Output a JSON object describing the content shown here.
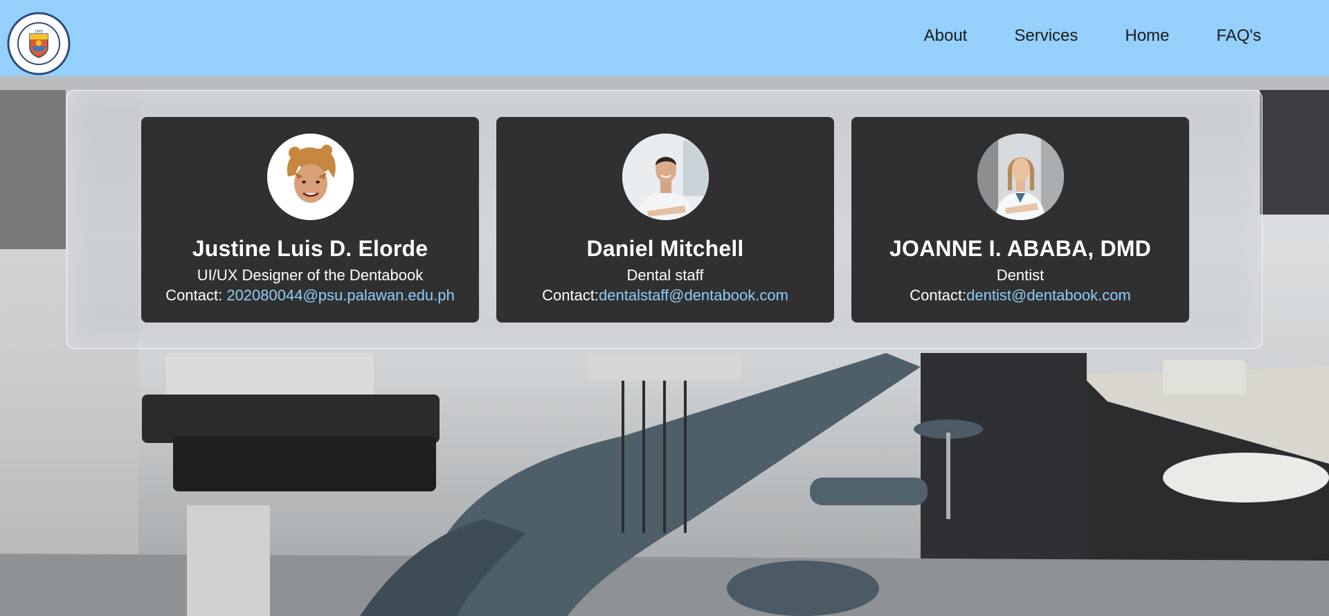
{
  "header": {
    "logo": {
      "icon": "university-seal-icon",
      "ring_text": "PALAWAN STATE UNIVERSITY",
      "bottom_text": "PHILIPPINES",
      "year": "1965"
    },
    "nav": [
      {
        "label": "About"
      },
      {
        "label": "Services"
      },
      {
        "label": "Home"
      },
      {
        "label": "FAQ's"
      }
    ],
    "background_color": "#94d0fb"
  },
  "team": [
    {
      "avatar": "cartoon-portrait-avatar",
      "name": "Justine Luis D. Elorde",
      "role": "UI/UX Designer of the Dentabook",
      "contact_label": "Contact: ",
      "email": "202080044@psu.palawan.edu.ph"
    },
    {
      "avatar": "male-staff-photo-avatar",
      "name": "Daniel Mitchell",
      "role": "Dental staff",
      "contact_label": "Contact:",
      "email": "dentalstaff@dentabook.com"
    },
    {
      "avatar": "female-dentist-photo-avatar",
      "name": "JOANNE I. ABABA, DMD",
      "role": "Dentist",
      "contact_label": "Contact:",
      "email": "dentist@dentabook.com"
    }
  ],
  "colors": {
    "card_bg": "#303030",
    "link": "#8fcdf7",
    "text": "#ffffff"
  }
}
